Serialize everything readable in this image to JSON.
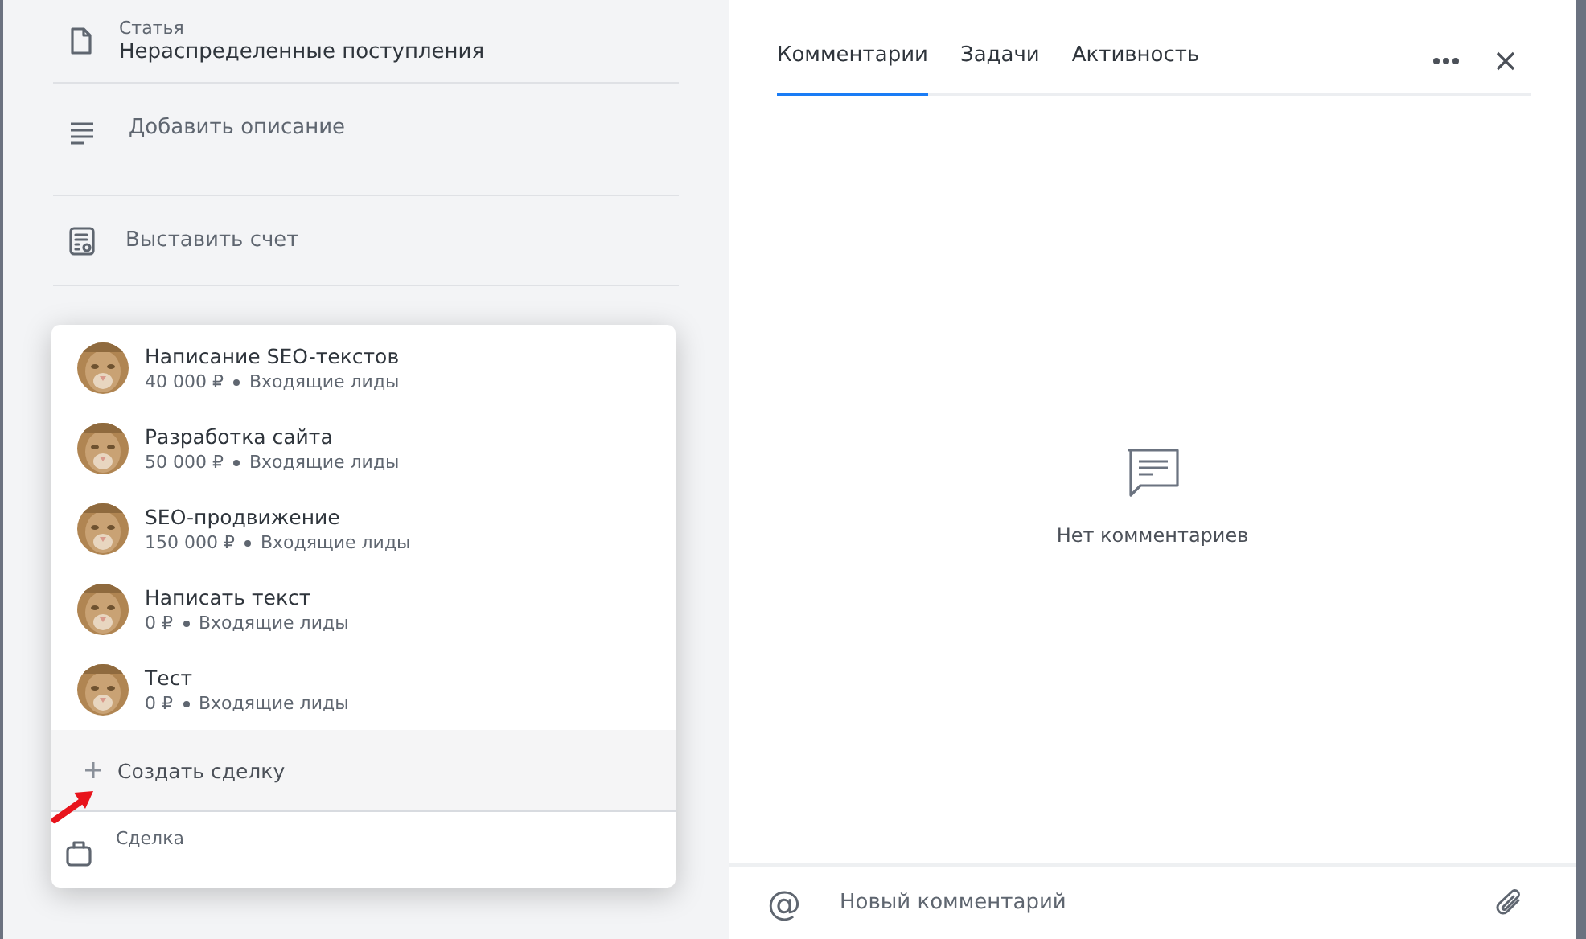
{
  "left_panel": {
    "article": {
      "label": "Статья",
      "value": "Нераспределенные поступления"
    },
    "actions": [
      {
        "kind": "description",
        "label": "Добавить описание"
      },
      {
        "kind": "invoice",
        "label": "Выставить счет"
      }
    ]
  },
  "deal_dropdown": {
    "items": [
      {
        "title": "Написание SEO-текстов",
        "amount": "40 000 ₽",
        "stage": "Входящие лиды"
      },
      {
        "title": "Разработка сайта",
        "amount": "50 000 ₽",
        "stage": "Входящие лиды"
      },
      {
        "title": "SEO-продвижение",
        "amount": "150 000 ₽",
        "stage": "Входящие лиды"
      },
      {
        "title": "Написать текст",
        "amount": "0 ₽",
        "stage": "Входящие лиды"
      },
      {
        "title": "Тест",
        "amount": "0 ₽",
        "stage": "Входящие лиды"
      }
    ],
    "create_label": "Создать сделку",
    "deal_field": {
      "label": "Сделка"
    }
  },
  "comments_panel": {
    "tabs": [
      {
        "label": "Комментарии",
        "selected": true
      },
      {
        "label": "Задачи",
        "selected": false
      },
      {
        "label": "Активность",
        "selected": false
      }
    ],
    "empty_text": "Нет комментариев",
    "input": {
      "mention_symbol": "@",
      "placeholder": "Новый комментарий"
    }
  }
}
